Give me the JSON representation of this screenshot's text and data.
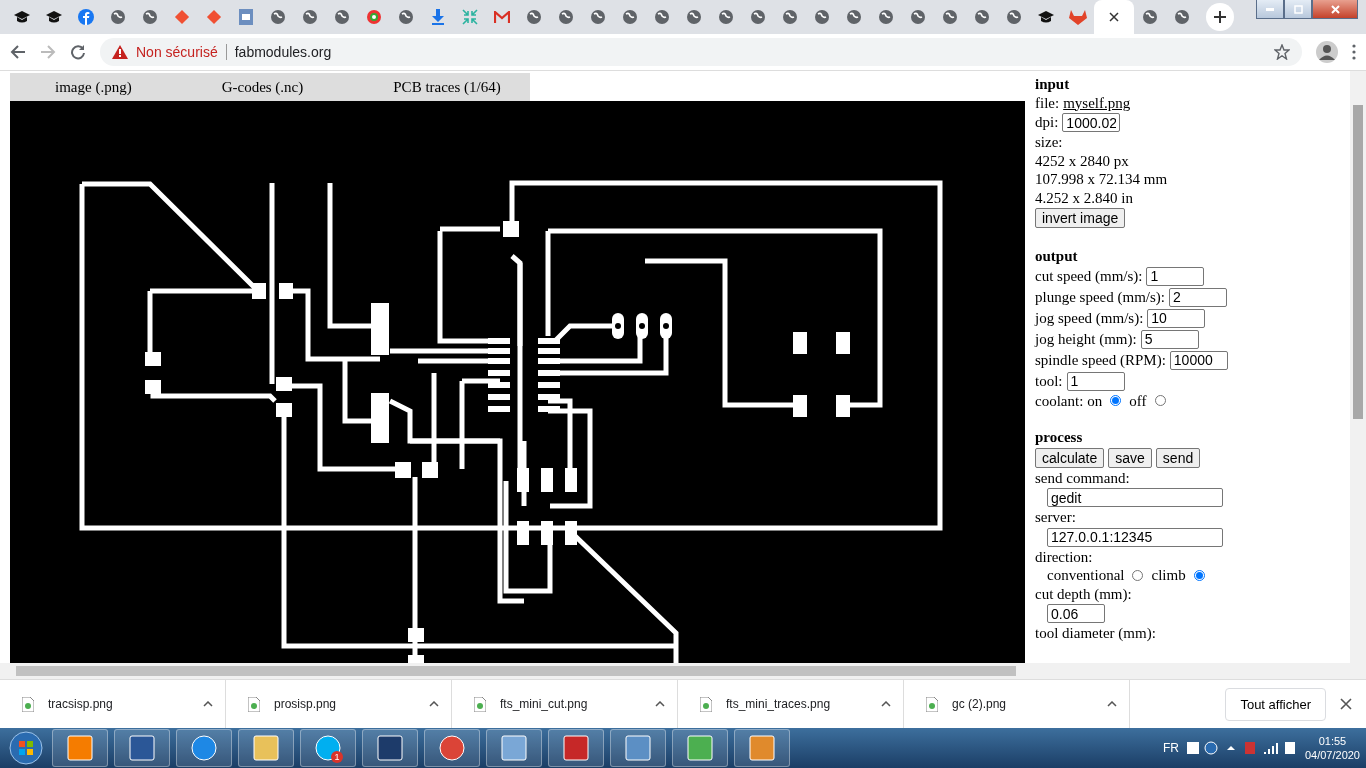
{
  "browser_tabs": [
    {
      "kind": "cap",
      "selected": false
    },
    {
      "kind": "cap",
      "selected": false
    },
    {
      "kind": "facebook",
      "selected": false
    },
    {
      "kind": "globe",
      "selected": false
    },
    {
      "kind": "globe",
      "selected": false
    },
    {
      "kind": "git",
      "selected": false
    },
    {
      "kind": "git",
      "selected": false
    },
    {
      "kind": "doc",
      "selected": false
    },
    {
      "kind": "globe",
      "selected": false
    },
    {
      "kind": "globe",
      "selected": false
    },
    {
      "kind": "globe",
      "selected": false
    },
    {
      "kind": "color",
      "selected": false
    },
    {
      "kind": "globe",
      "selected": false
    },
    {
      "kind": "download",
      "selected": false
    },
    {
      "kind": "compress",
      "selected": false
    },
    {
      "kind": "mail",
      "selected": false
    },
    {
      "kind": "globe",
      "selected": false
    },
    {
      "kind": "globe",
      "selected": false
    },
    {
      "kind": "globe",
      "selected": false
    },
    {
      "kind": "globe",
      "selected": false
    },
    {
      "kind": "globe",
      "selected": false
    },
    {
      "kind": "globe",
      "selected": false
    },
    {
      "kind": "globe",
      "selected": false
    },
    {
      "kind": "globe",
      "selected": false
    },
    {
      "kind": "globe",
      "selected": false
    },
    {
      "kind": "globe",
      "selected": false
    },
    {
      "kind": "globe",
      "selected": false
    },
    {
      "kind": "globe",
      "selected": false
    },
    {
      "kind": "globe",
      "selected": false
    },
    {
      "kind": "globe",
      "selected": false
    },
    {
      "kind": "globe",
      "selected": false
    },
    {
      "kind": "globe",
      "selected": false
    },
    {
      "kind": "cap",
      "selected": false
    },
    {
      "kind": "fox",
      "selected": false
    },
    {
      "kind": "blank",
      "selected": true
    },
    {
      "kind": "globe",
      "selected": false
    },
    {
      "kind": "globe",
      "selected": false
    }
  ],
  "address_bar": {
    "warning": "Non sécurisé",
    "url": "fabmodules.org"
  },
  "page_tabs": [
    "image (.png)",
    "G-codes (.nc)",
    "PCB traces (1/64)"
  ],
  "input": {
    "heading": "input",
    "file_label": "file:",
    "file_name": "myself.png",
    "dpi_label": "dpi:",
    "dpi_value": "1000.02",
    "size_label": "size:",
    "size_lines": [
      "4252 x 2840 px",
      "107.998 x 72.134 mm",
      "4.252 x 2.840 in"
    ],
    "button": "invert image"
  },
  "output": {
    "heading": "output",
    "fields": [
      {
        "label": "cut speed (mm/s):",
        "value": "1"
      },
      {
        "label": "plunge speed (mm/s):",
        "value": "2"
      },
      {
        "label": "jog speed (mm/s):",
        "value": "10"
      },
      {
        "label": "jog height (mm):",
        "value": "5"
      },
      {
        "label": "spindle speed (RPM):",
        "value": "10000"
      },
      {
        "label": "tool:",
        "value": "1"
      }
    ],
    "coolant": {
      "label": "coolant:",
      "options": [
        {
          "label": "on",
          "selected": true
        },
        {
          "label": "off",
          "selected": false
        }
      ]
    }
  },
  "process": {
    "heading": "process",
    "buttons": [
      "calculate",
      "save",
      "send"
    ],
    "send_command_label": "send command:",
    "send_command": "gedit",
    "server_label": "server:",
    "server": "127.0.0.1:12345",
    "direction_label": "direction:",
    "direction_options": [
      {
        "label": "conventional",
        "selected": false
      },
      {
        "label": "climb",
        "selected": true
      }
    ],
    "cut_depth_label": "cut depth (mm):",
    "cut_depth": "0.06",
    "tool_diameter_label": "tool diameter (mm):"
  },
  "downloads": [
    "tracsisp.png",
    "prosisp.png",
    "fts_mini_cut.png",
    "fts_mini_traces.png",
    "gc (2).png"
  ],
  "downloads_show_all": "Tout afficher",
  "taskbar": {
    "apps": [
      {
        "kind": "media"
      },
      {
        "kind": "word"
      },
      {
        "kind": "ie"
      },
      {
        "kind": "folder"
      },
      {
        "kind": "skype",
        "badge": "1"
      },
      {
        "kind": "bracket"
      },
      {
        "kind": "chrome"
      },
      {
        "kind": "panel"
      },
      {
        "kind": "pdf"
      },
      {
        "kind": "photo"
      },
      {
        "kind": "diamond"
      },
      {
        "kind": "letter"
      }
    ],
    "language": "FR",
    "time": "01:55",
    "date": "04/07/2020"
  }
}
